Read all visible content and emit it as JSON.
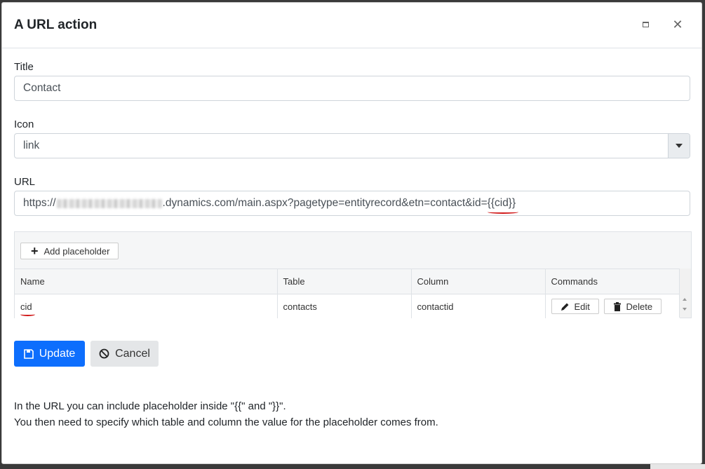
{
  "dialog": {
    "title": "A URL action"
  },
  "form": {
    "title_label": "Title",
    "title_value": "Contact",
    "icon_label": "Icon",
    "icon_value": "link",
    "url_label": "URL",
    "url_prefix": "https://",
    "url_middle": ".dynamics.com/main.aspx?pagetype=entityrecord&etn=contact&id=",
    "url_placeholder": "{{cid}}"
  },
  "placeholders": {
    "add_label": "Add placeholder",
    "columns": [
      "Name",
      "Table",
      "Column",
      "Commands"
    ],
    "rows": [
      {
        "name": "cid",
        "table": "contacts",
        "column": "contactid",
        "edit": "Edit",
        "delete": "Delete"
      }
    ]
  },
  "actions": {
    "update_label": "Update",
    "cancel_label": "Cancel"
  },
  "help": {
    "line1": "In the URL you can include placeholder inside \"{{\" and \"}}\".",
    "line2": "You then need to specify which table and column the value for the placeholder comes from."
  },
  "colors": {
    "primary": "#0d6efd",
    "annotation": "#d11a1a"
  }
}
